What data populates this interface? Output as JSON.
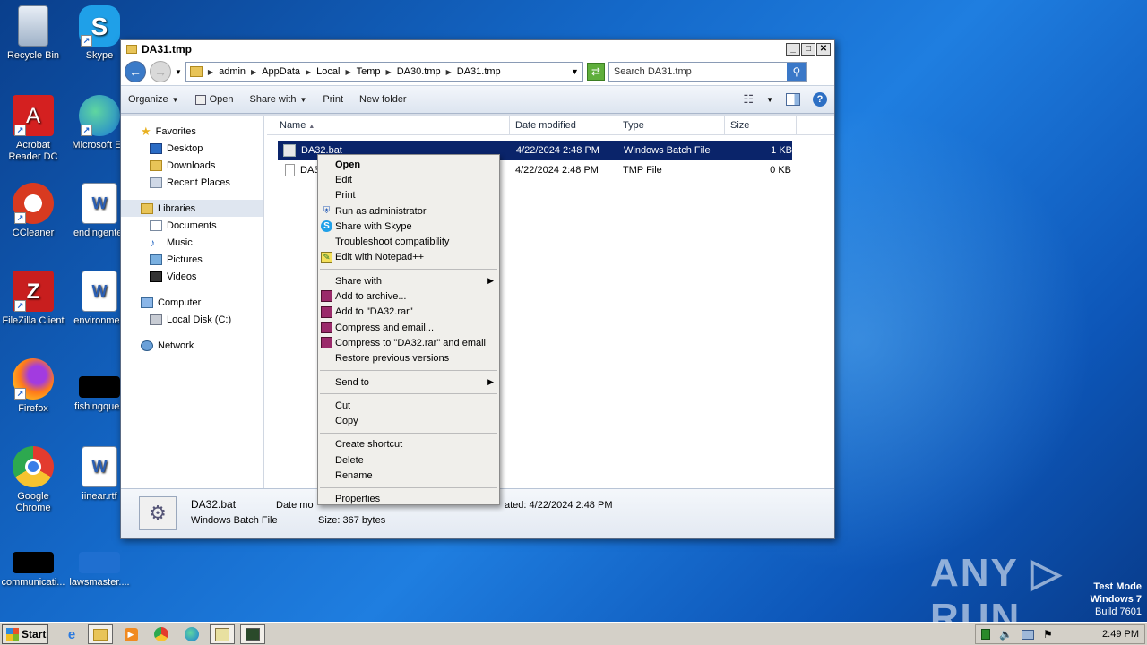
{
  "desktop": {
    "icons": [
      {
        "label": "Recycle Bin",
        "icon": "recycle-bin-icon"
      },
      {
        "label": "Skype",
        "icon": "skype-icon"
      },
      {
        "label": "Acrobat Reader DC",
        "icon": "acrobat-icon"
      },
      {
        "label": "Microsoft Ed",
        "icon": "edge-icon"
      },
      {
        "label": "CCleaner",
        "icon": "ccleaner-icon"
      },
      {
        "label": "endingenter",
        "icon": "word-doc-icon"
      },
      {
        "label": "FileZilla Client",
        "icon": "filezilla-icon"
      },
      {
        "label": "environmen",
        "icon": "word-doc-icon"
      },
      {
        "label": "Firefox",
        "icon": "firefox-icon"
      },
      {
        "label": "fishingques",
        "icon": "black-file-icon"
      },
      {
        "label": "Google Chrome",
        "icon": "chrome-icon"
      },
      {
        "label": "iinear.rtf",
        "icon": "word-doc-icon"
      },
      {
        "label": "communicati...",
        "icon": "black-file-icon"
      },
      {
        "label": "lawsmaster....",
        "icon": "blank-file-icon"
      }
    ]
  },
  "window": {
    "title": "DA31.tmp",
    "min": "_",
    "max": "□",
    "close": "✕",
    "breadcrumb": [
      "admin",
      "AppData",
      "Local",
      "Temp",
      "DA30.tmp",
      "DA31.tmp"
    ],
    "search_placeholder": "Search DA31.tmp",
    "toolbar": {
      "organize": "Organize",
      "open": "Open",
      "share_with": "Share with",
      "print": "Print",
      "new_folder": "New folder"
    }
  },
  "navpane": {
    "favorites": "Favorites",
    "desktop": "Desktop",
    "downloads": "Downloads",
    "recent_places": "Recent Places",
    "libraries": "Libraries",
    "documents": "Documents",
    "music": "Music",
    "pictures": "Pictures",
    "videos": "Videos",
    "computer": "Computer",
    "local_disk": "Local Disk (C:)",
    "network": "Network"
  },
  "files": {
    "columns": {
      "name": "Name",
      "date_modified": "Date modified",
      "type": "Type",
      "size": "Size"
    },
    "rows": [
      {
        "name": "DA32.bat",
        "date": "4/22/2024 2:48 PM",
        "type": "Windows Batch File",
        "size": "1 KB"
      },
      {
        "name": "DA3",
        "date": "4/22/2024 2:48 PM",
        "type": "TMP File",
        "size": "0 KB"
      }
    ]
  },
  "details": {
    "filename": "DA32.bat",
    "filetype": "Windows Batch File",
    "date_modified_label": "Date mo",
    "date_created": "ated: 4/22/2024 2:48 PM",
    "size": "Size: 367 bytes"
  },
  "context_menu": {
    "open": "Open",
    "edit": "Edit",
    "print": "Print",
    "run_as_admin": "Run as administrator",
    "share_skype": "Share with Skype",
    "troubleshoot": "Troubleshoot compatibility",
    "edit_notepad": "Edit with Notepad++",
    "share_with": "Share with",
    "add_archive": "Add to archive...",
    "add_rar": "Add to \"DA32.rar\"",
    "compress_email": "Compress and email...",
    "compress_rar_email": "Compress to \"DA32.rar\" and email",
    "restore": "Restore previous versions",
    "send_to": "Send to",
    "cut": "Cut",
    "copy": "Copy",
    "create_shortcut": "Create shortcut",
    "delete": "Delete",
    "rename": "Rename",
    "properties": "Properties"
  },
  "taskbar": {
    "start": "Start",
    "clock": "2:49 PM"
  },
  "overlay": {
    "watermark": "ANY ▷ RUN",
    "test_mode": "Test Mode",
    "os": "Windows 7",
    "build": "Build 7601"
  }
}
